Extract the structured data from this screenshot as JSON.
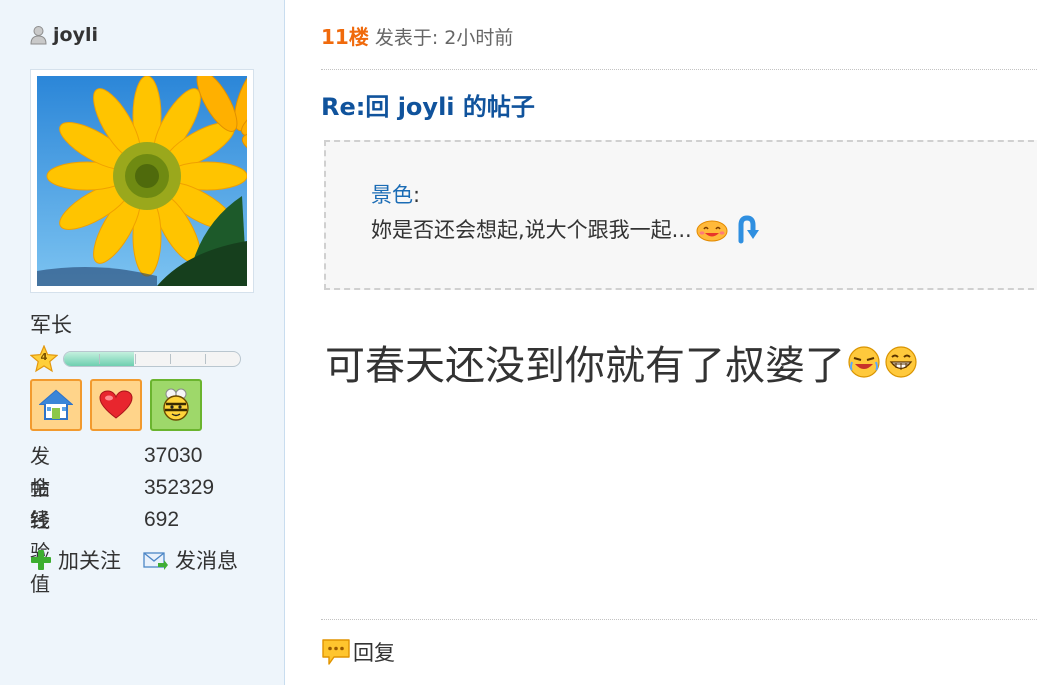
{
  "user": {
    "name": "joyli",
    "rank": "军长",
    "level": "4",
    "level_progress": 0.4,
    "stats": [
      {
        "label": "发帖",
        "value": "37030"
      },
      {
        "label": "金钱",
        "value": "352329"
      },
      {
        "label": "经验值",
        "value": "692"
      }
    ],
    "badges": [
      "house-icon",
      "heart-icon",
      "bee-icon"
    ],
    "follow_label": "加关注",
    "message_label": "发消息"
  },
  "post": {
    "floor": "11楼",
    "posted_text": "发表于: 2小时前",
    "title": "Re:回 joyli 的帖子",
    "quote": {
      "author": "景色",
      "colon": ":",
      "text": "妳是否还会想起,说大个跟我一起..."
    },
    "content": "可春天还没到你就有了叔婆了",
    "reply_label": "回复"
  },
  "colors": {
    "floor": "#f06a0c",
    "title": "#10539c",
    "quote_author": "#1b6cb5",
    "sidebar_bg": "#eef5fb"
  }
}
